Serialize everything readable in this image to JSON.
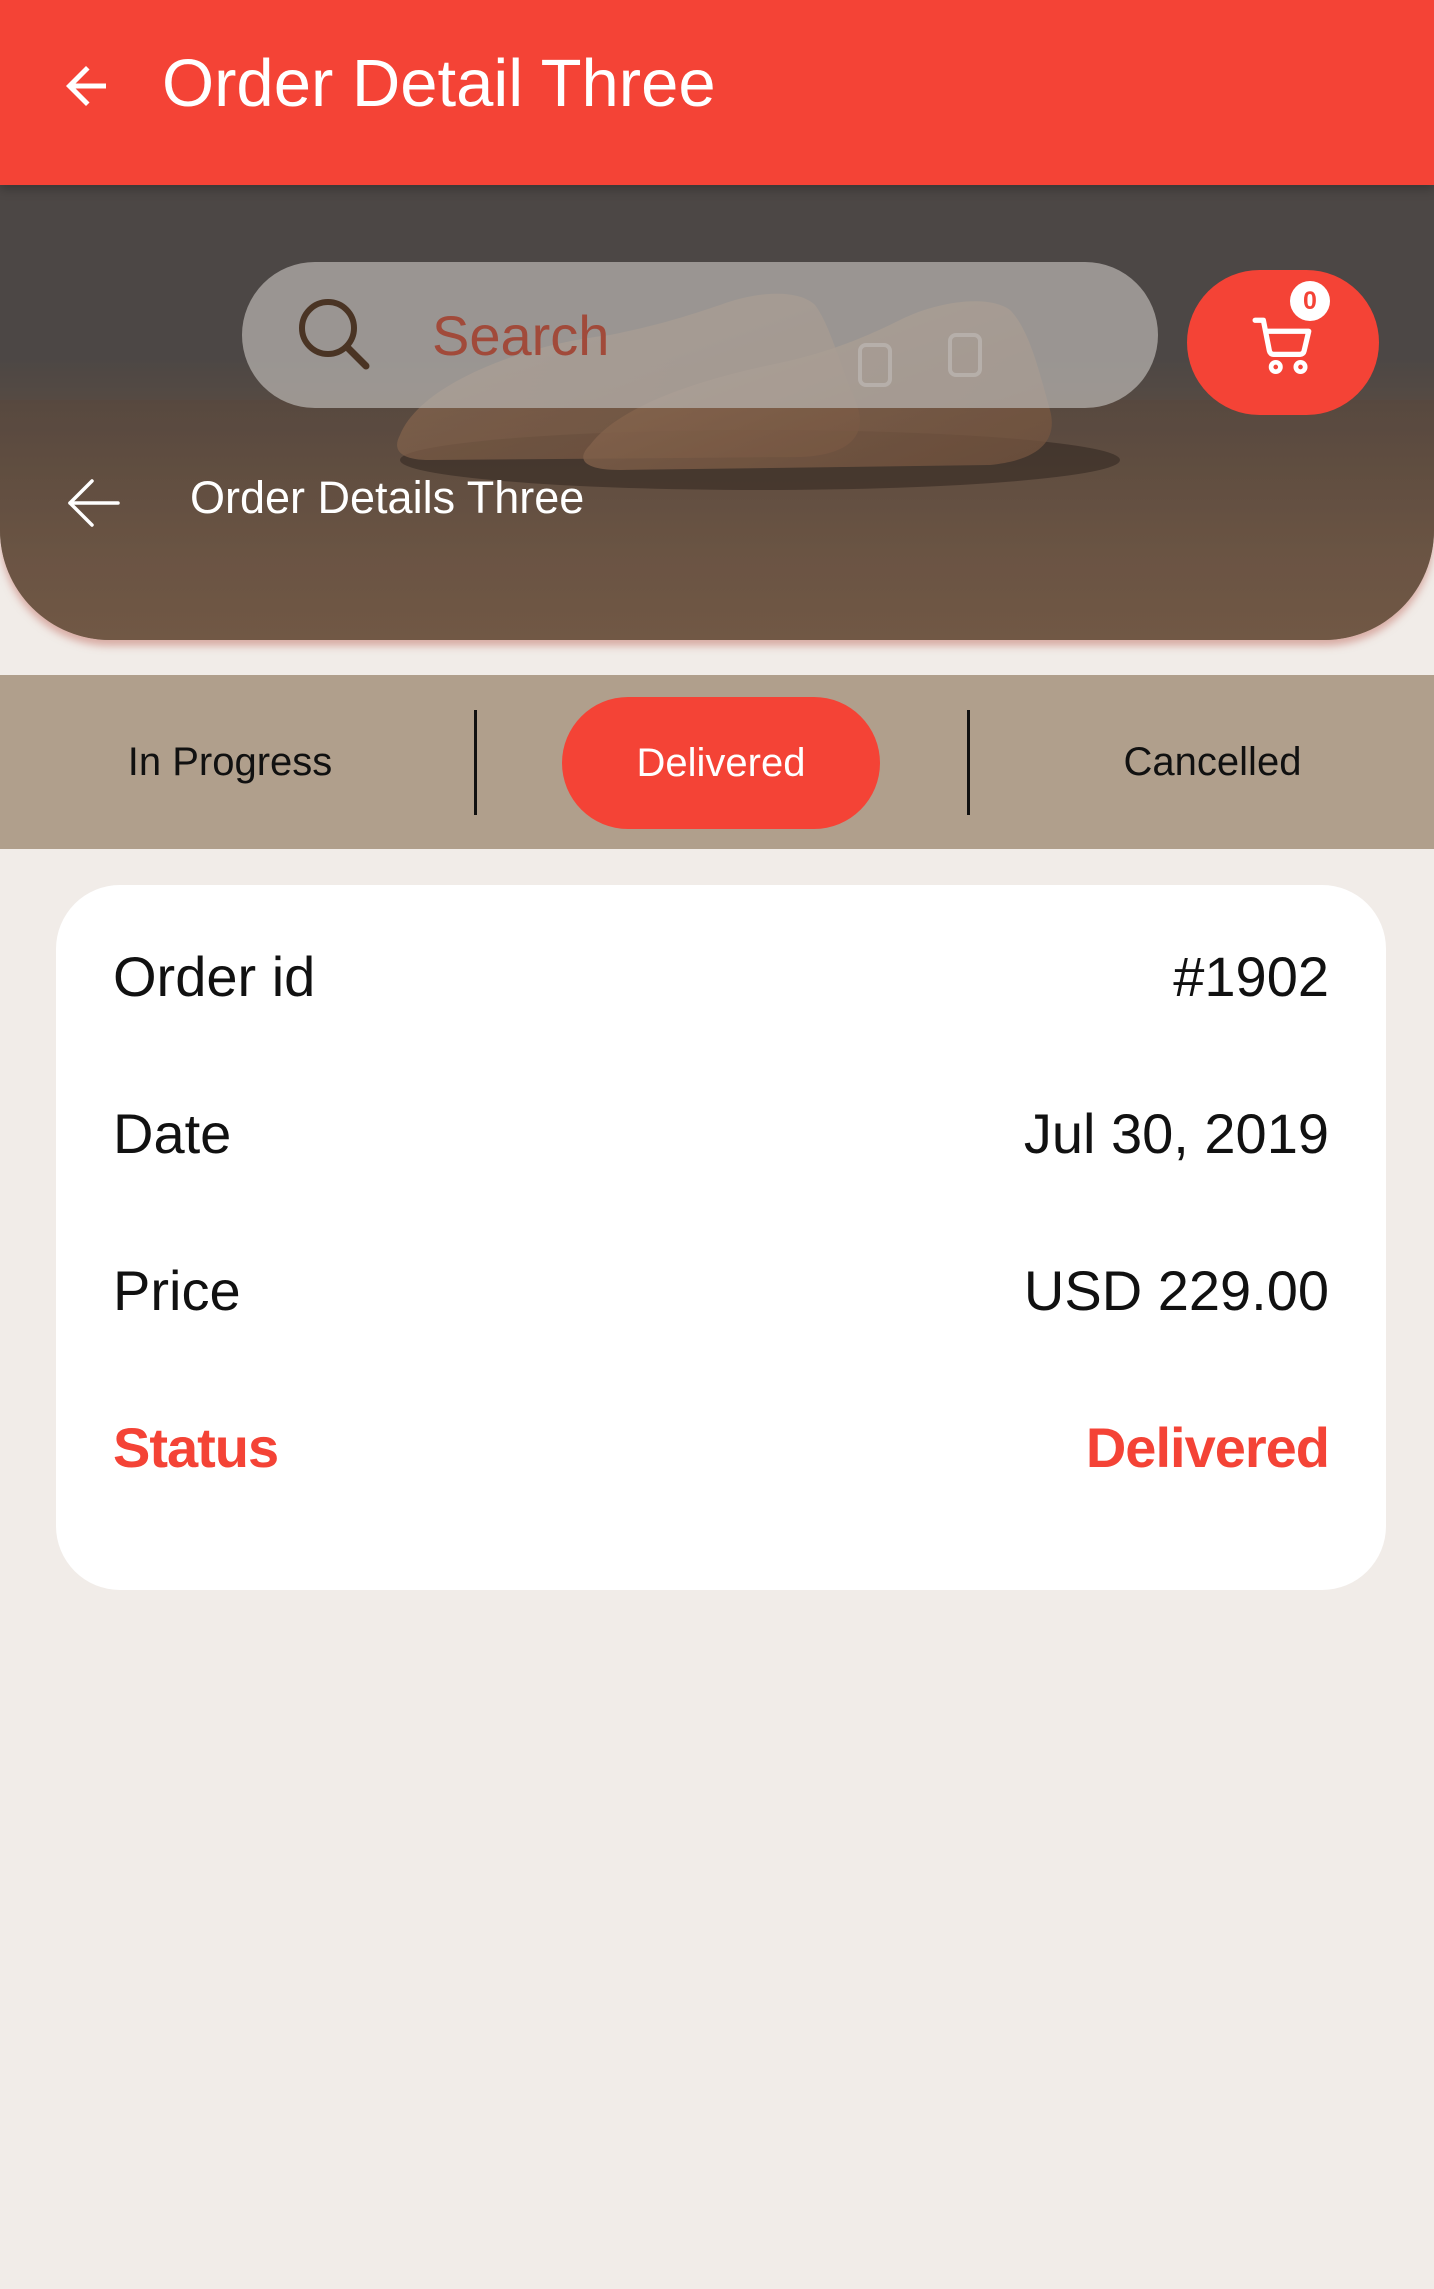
{
  "appbar": {
    "title": "Order Detail Three",
    "back_icon": "arrow-back-icon",
    "background_color": "#f44336"
  },
  "hero": {
    "search": {
      "placeholder": "Search",
      "icon": "search-icon"
    },
    "cart": {
      "icon": "cart-icon",
      "badge_count": "0"
    },
    "back_icon": "arrow-back-icon",
    "title": "Order Details Three"
  },
  "tabs": {
    "items": [
      {
        "label": "In Progress"
      },
      {
        "label": "Delivered"
      },
      {
        "label": "Cancelled"
      }
    ],
    "active_label": "Delivered",
    "active_color": "#f44336"
  },
  "order": {
    "rows": [
      {
        "label": "Order id",
        "value": "#1902"
      },
      {
        "label": "Date",
        "value": "Jul 30, 2019"
      },
      {
        "label": "Price",
        "value": "USD 229.00"
      },
      {
        "label": "Status",
        "value": "Delivered"
      }
    ],
    "status_color": "#f44336"
  }
}
